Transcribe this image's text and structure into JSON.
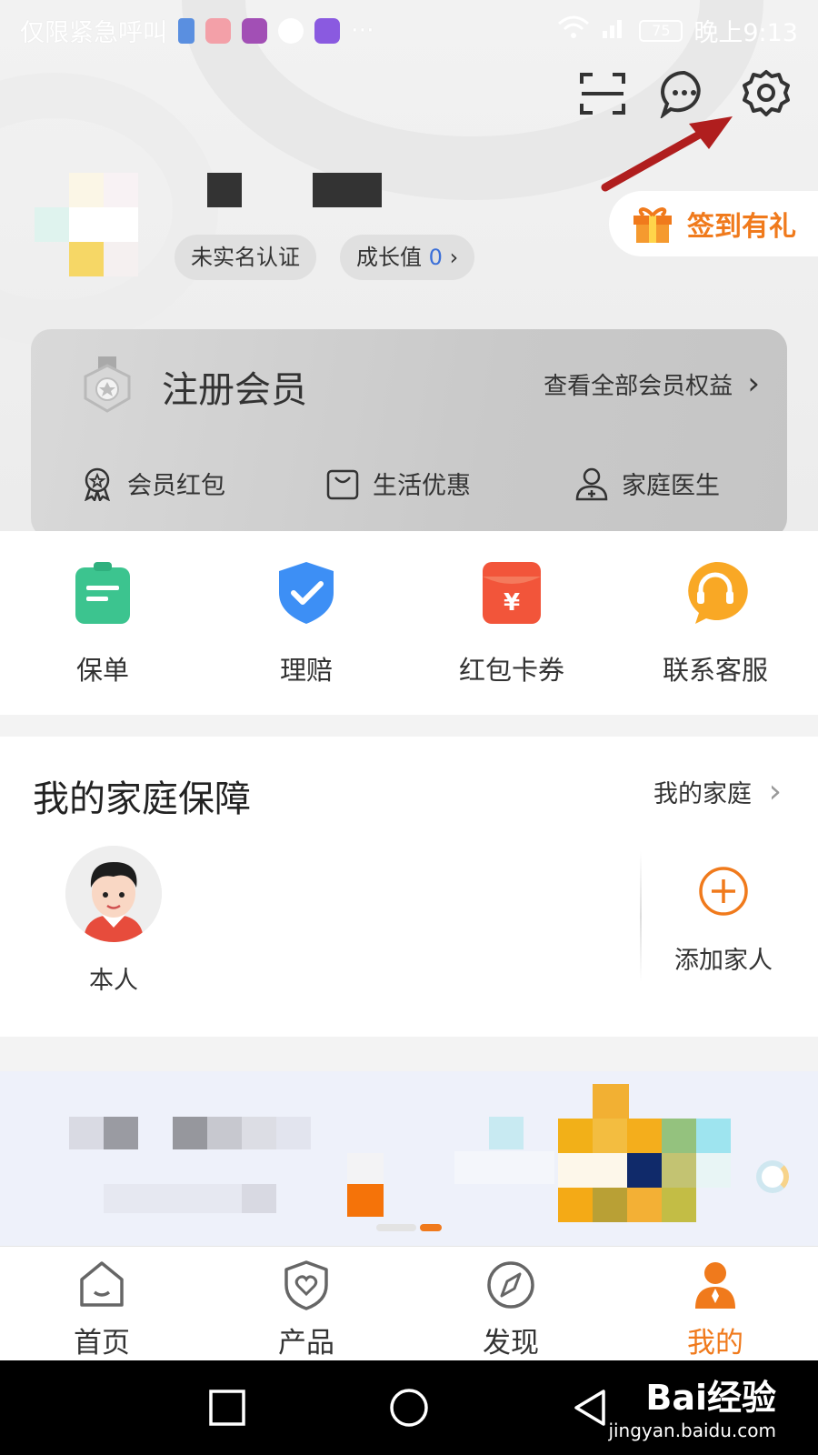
{
  "status_bar": {
    "emergency_text": "仅限紧急呼叫",
    "battery": "75",
    "time": "晚上9:13"
  },
  "profile": {
    "verify_chip": "未实名认证",
    "growth_label": "成长值",
    "growth_value": "0",
    "checkin_label": "签到有礼"
  },
  "member_card": {
    "title": "注册会员",
    "view_all": "查看全部会员权益",
    "perks": [
      {
        "label": "会员红包",
        "icon": "ribbon-badge-icon"
      },
      {
        "label": "生活优惠",
        "icon": "shopping-bag-icon"
      },
      {
        "label": "家庭医生",
        "icon": "doctor-icon"
      }
    ]
  },
  "quick_actions": [
    {
      "label": "保单",
      "icon": "policy-clipboard-icon",
      "color": "#3cc48f"
    },
    {
      "label": "理赔",
      "icon": "shield-check-icon",
      "color": "#3d8ff5"
    },
    {
      "label": "红包卡券",
      "icon": "red-envelope-icon",
      "color": "#f2553a"
    },
    {
      "label": "联系客服",
      "icon": "headset-icon",
      "color": "#f9a825"
    }
  ],
  "family": {
    "title": "我的家庭保障",
    "link": "我的家庭",
    "self_label": "本人",
    "add_label": "添加家人"
  },
  "tabs": [
    {
      "label": "首页",
      "icon": "home-icon"
    },
    {
      "label": "产品",
      "icon": "shield-heart-icon"
    },
    {
      "label": "发现",
      "icon": "compass-icon"
    },
    {
      "label": "我的",
      "icon": "person-icon",
      "active": true
    }
  ],
  "watermark": {
    "brand": "Bai经验",
    "url": "jingyan.baidu.com"
  },
  "colors": {
    "accent": "#f07a1c",
    "link_blue": "#3b6fd8"
  }
}
